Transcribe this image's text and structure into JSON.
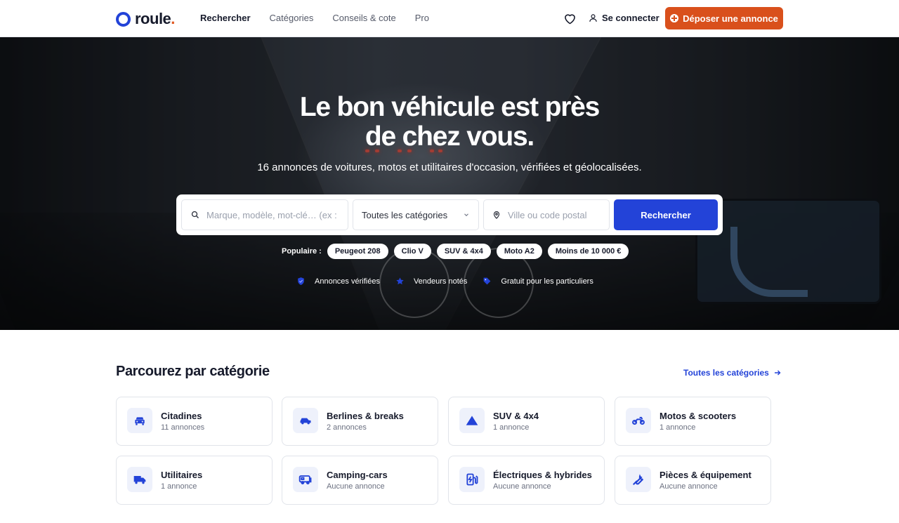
{
  "header": {
    "logo_text": "roule",
    "logo_dot": ".",
    "nav": [
      "Rechercher",
      "Catégories",
      "Conseils & cote",
      "Pro"
    ],
    "login_label": "Se connecter",
    "post_label": "Déposer une annonce"
  },
  "hero": {
    "title_line1": "Le bon véhicule est près",
    "title_line2": "de chez vous.",
    "subtitle": "16 annonces de voitures, motos et utilitaires d'occasion, vérifiées et géolocalisées.",
    "search": {
      "query_placeholder": "Marque, modèle, mot-clé… (ex :",
      "category_value": "Toutes les catégories",
      "location_placeholder": "Ville ou code postal",
      "button_label": "Rechercher"
    },
    "popular_label": "Populaire :",
    "popular": [
      "Peugeot 208",
      "Clio V",
      "SUV & 4x4",
      "Moto A2",
      "Moins de 10 000 €"
    ],
    "trust": [
      "Annonces vérifiées",
      "Vendeurs notés",
      "Gratuit pour les particuliers"
    ]
  },
  "categories": {
    "title": "Parcourez par catégorie",
    "all_label": "Toutes les catégories",
    "items": [
      {
        "name": "Citadines",
        "count": "11 annonces",
        "icon": "car-icon"
      },
      {
        "name": "Berlines & breaks",
        "count": "2 annonces",
        "icon": "sedan-icon"
      },
      {
        "name": "SUV & 4x4",
        "count": "1 annonce",
        "icon": "mountain-icon"
      },
      {
        "name": "Motos & scooters",
        "count": "1 annonce",
        "icon": "motorcycle-icon"
      },
      {
        "name": "Utilitaires",
        "count": "1 annonce",
        "icon": "truck-icon"
      },
      {
        "name": "Camping-cars",
        "count": "Aucune annonce",
        "icon": "camper-icon"
      },
      {
        "name": "Électriques & hybrides",
        "count": "Aucune annonce",
        "icon": "ev-charger-icon"
      },
      {
        "name": "Pièces & équipement",
        "count": "Aucune annonce",
        "icon": "wrench-icon"
      }
    ]
  },
  "colors": {
    "brand_blue": "#2343d8",
    "accent_orange": "#d9501c"
  }
}
